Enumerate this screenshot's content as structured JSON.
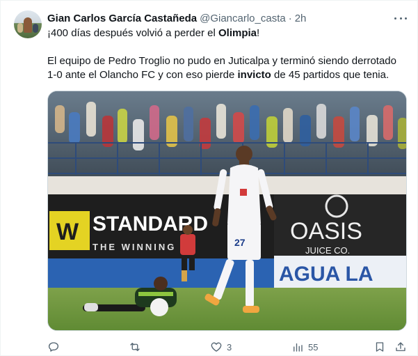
{
  "tweet": {
    "author_name": "Gian Carlos García Castañeda",
    "handle": "@Giancarlo_casta",
    "separator": "·",
    "time": "2h",
    "line1_pre": "¡400 días después volvió a perder el ",
    "line1_bold": "Olimpia",
    "line1_post": "!",
    "line2": "El equipo de Pedro Troglio no pudo en Juticalpa y terminó siendo derrotado",
    "line3_pre": "1-0 ante el Olancho FC y con eso pierde ",
    "line3_bold": "invicto",
    "line3_post": " de 45 partidos que tenia."
  },
  "image": {
    "sign_standard": "STANDARD",
    "sign_winning": "THE WINNING C",
    "sign_oasis": "OASIS",
    "sign_juice": "JUICE CO.",
    "sign_agua": "AGUA LA",
    "player_number": "27"
  },
  "actions": {
    "reply_count": "",
    "retweet_count": "",
    "like_count": "3",
    "views_count": "55"
  },
  "icons": [
    "reply-icon",
    "retweet-icon",
    "like-icon",
    "views-icon",
    "bookmark-icon",
    "share-icon",
    "more-icon"
  ]
}
